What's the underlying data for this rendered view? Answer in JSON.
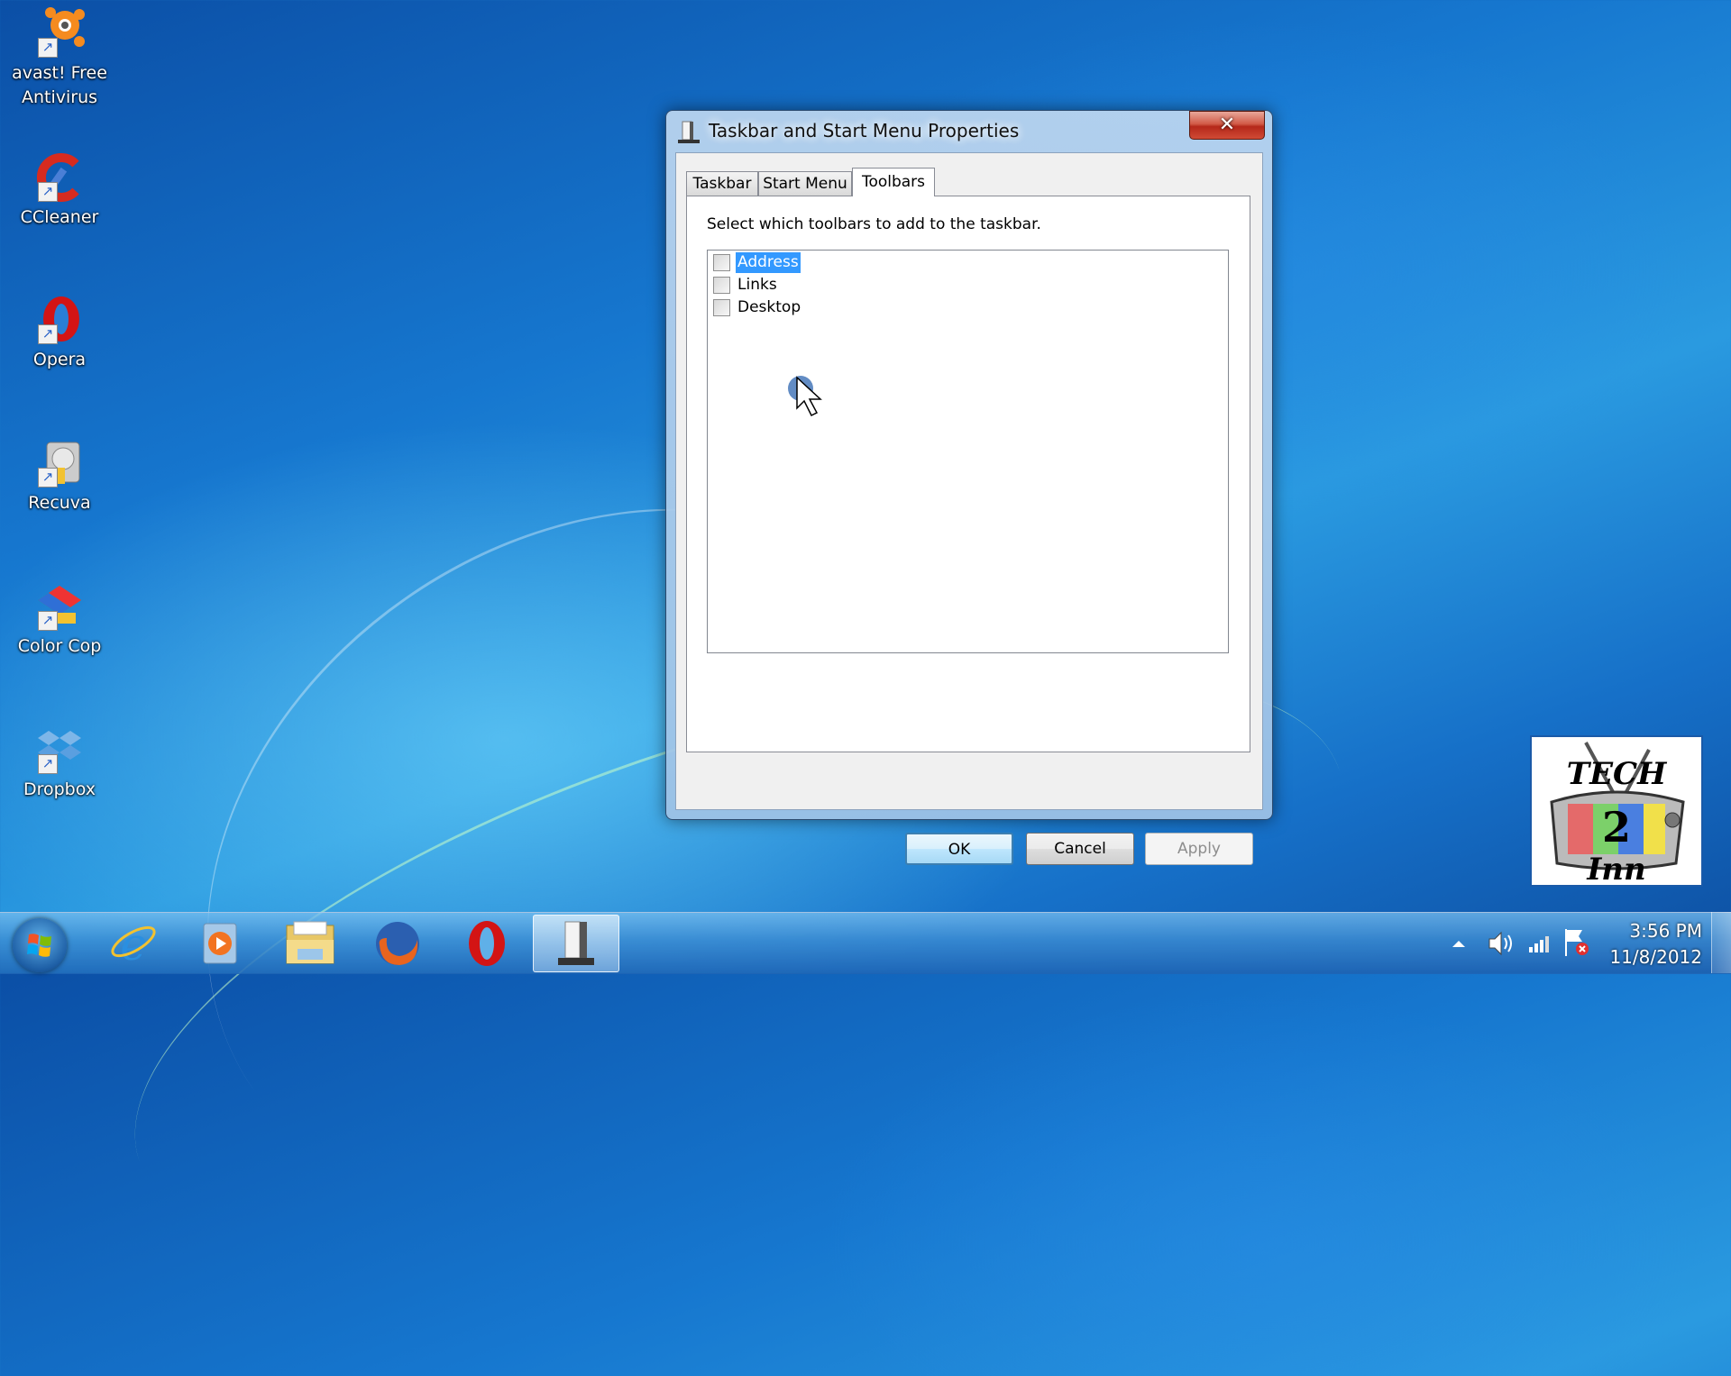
{
  "desktop": {
    "icons": [
      {
        "label_line1": "avast! Free",
        "label_line2": "Antivirus",
        "icon": "avast-icon"
      },
      {
        "label_line1": "CCleaner",
        "label_line2": "",
        "icon": "ccleaner-icon"
      },
      {
        "label_line1": "Opera",
        "label_line2": "",
        "icon": "opera-icon"
      },
      {
        "label_line1": "Recuva",
        "label_line2": "",
        "icon": "recuva-icon"
      },
      {
        "label_line1": "Color Cop",
        "label_line2": "",
        "icon": "colorcop-icon"
      },
      {
        "label_line1": "Dropbox",
        "label_line2": "",
        "icon": "dropbox-icon"
      }
    ]
  },
  "dialog": {
    "title": "Taskbar and Start Menu Properties",
    "close_glyph": "✕",
    "tabs": [
      {
        "label": "Taskbar",
        "active": false
      },
      {
        "label": "Start Menu",
        "active": false
      },
      {
        "label": "Toolbars",
        "active": true
      }
    ],
    "instruction": "Select which toolbars to add to the taskbar.",
    "toolbars": [
      {
        "label": "Address",
        "checked": false,
        "selected": true
      },
      {
        "label": "Links",
        "checked": false,
        "selected": false
      },
      {
        "label": "Desktop",
        "checked": false,
        "selected": false
      }
    ],
    "buttons": {
      "ok": "OK",
      "cancel": "Cancel",
      "apply": "Apply"
    }
  },
  "watermark": {
    "line1": "TECH",
    "line2": "2",
    "line3": "Inn"
  },
  "taskbar": {
    "pinned": [
      {
        "name": "internet-explorer",
        "icon": "ie-icon"
      },
      {
        "name": "windows-media-player",
        "icon": "media-player-icon"
      },
      {
        "name": "windows-explorer",
        "icon": "folder-icon"
      },
      {
        "name": "firefox",
        "icon": "firefox-icon"
      },
      {
        "name": "opera",
        "icon": "opera-icon"
      },
      {
        "name": "taskbar-properties",
        "icon": "taskbar-properties-icon",
        "active": true
      }
    ],
    "tray": {
      "time": "3:56 PM",
      "date": "11/8/2012"
    }
  }
}
